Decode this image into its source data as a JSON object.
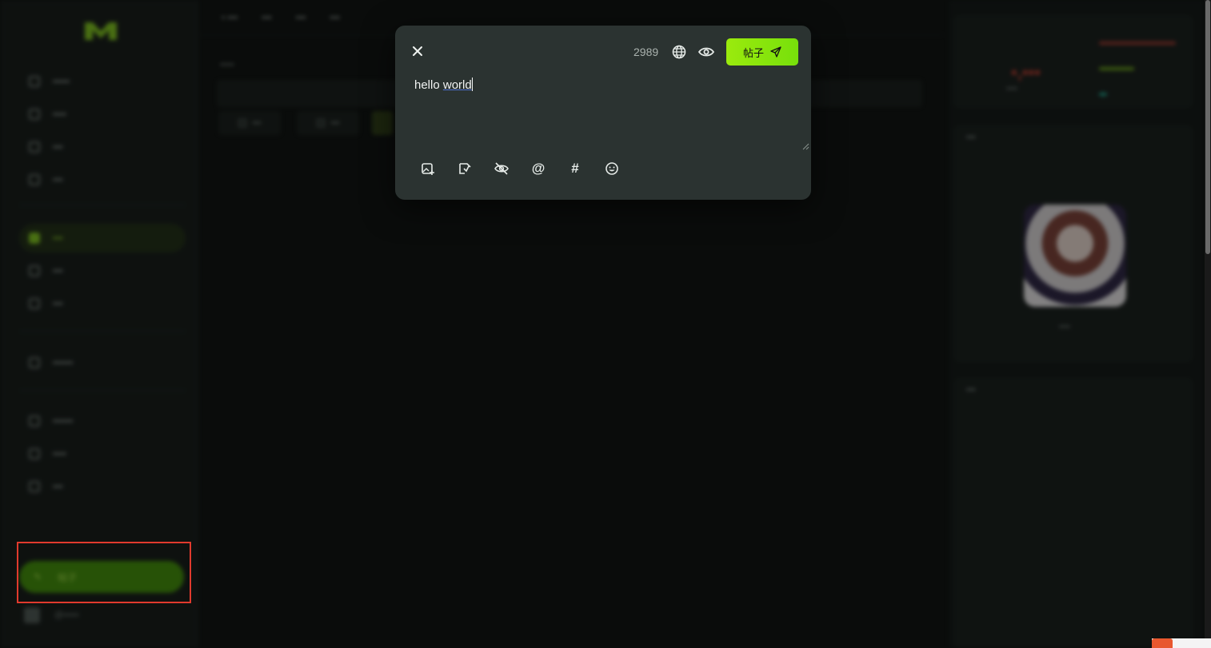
{
  "sidebar": {
    "nav_group_1": [
      "•••••",
      "••••",
      "•••",
      "•••"
    ],
    "nav_group_2": [
      "•••",
      "•••",
      "•••"
    ],
    "nav_group_3": [
      "••••••"
    ],
    "nav_group_4": [
      "••••••",
      "••••",
      "•••"
    ],
    "post_button_label": "帖子",
    "profile_label": "@•••••"
  },
  "main": {
    "tabs": [
      "• •••",
      "•••",
      "•••",
      "•••"
    ],
    "sub_label": "•••••",
    "chips": [
      "•••",
      "•••"
    ]
  },
  "right": {
    "stat_value": "•,•••",
    "stat_label": "••••",
    "card_title": "•••",
    "avatar_caption": "••••",
    "card2_title": "•••"
  },
  "compose": {
    "char_counter": "2989",
    "submit_label": "帖子",
    "text": "hello world",
    "text_plain": "hello ",
    "text_flagged": "world",
    "toolbar": {
      "image": "image-add-icon",
      "gif": "gif-icon",
      "sensitive": "eye-off-icon",
      "mention": "at-icon",
      "hashtag": "hashtag-icon",
      "emoji": "emoji-icon"
    }
  },
  "colors": {
    "accent": "#8ee50c",
    "modal_bg": "#2b3331",
    "highlight": "#e03a2d"
  }
}
